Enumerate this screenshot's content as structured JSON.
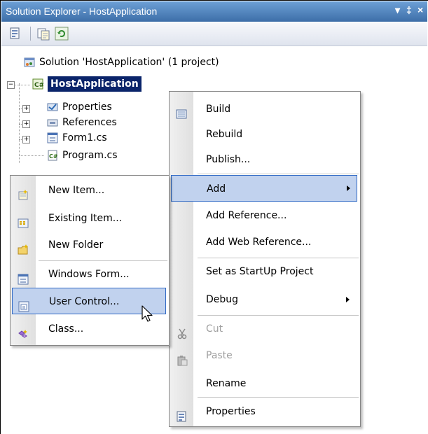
{
  "window": {
    "title": "Solution Explorer - HostApplication",
    "controls": {
      "dropdown": "▾",
      "pin": "‡",
      "close": "×"
    }
  },
  "toolbar": {
    "buttons": [
      {
        "icon": "properties-icon"
      },
      {
        "icon": "show-all-files-icon"
      },
      {
        "icon": "refresh-icon"
      }
    ]
  },
  "tree": {
    "solution": "Solution 'HostApplication' (1 project)",
    "project": "HostApplication",
    "items": [
      {
        "label": "Properties",
        "expandable": true
      },
      {
        "label": "References",
        "expandable": true
      },
      {
        "label": "Form1.cs",
        "expandable": true
      },
      {
        "label": "Program.cs",
        "expandable": false
      }
    ]
  },
  "context_menu": {
    "items": [
      {
        "label": "Build",
        "icon": "build-icon"
      },
      {
        "label": "Rebuild"
      },
      {
        "label": "Publish..."
      },
      {
        "label": "Add",
        "submenu": true,
        "highlighted": true
      },
      {
        "label": "Add Reference..."
      },
      {
        "label": "Add Web Reference..."
      },
      {
        "label": "Set as StartUp Project"
      },
      {
        "label": "Debug",
        "submenu": true
      },
      {
        "label": "Cut",
        "disabled": true,
        "icon": "cut-icon"
      },
      {
        "label": "Paste",
        "disabled": true,
        "icon": "paste-icon"
      },
      {
        "label": "Rename"
      },
      {
        "label": "Properties",
        "icon": "properties-icon"
      }
    ]
  },
  "add_submenu": {
    "items": [
      {
        "label": "New Item...",
        "icon": "new-item-icon"
      },
      {
        "label": "Existing Item...",
        "icon": "existing-item-icon"
      },
      {
        "label": "New Folder",
        "icon": "new-folder-icon"
      },
      {
        "label": "Windows Form...",
        "icon": "windows-form-icon"
      },
      {
        "label": "User Control...",
        "icon": "user-control-icon",
        "highlighted": true
      },
      {
        "label": "Class...",
        "icon": "class-icon"
      }
    ]
  },
  "colors": {
    "title_bar": "#3d6ea8",
    "selection": "#0a246a",
    "menu_highlight": "#c1d2ee",
    "menu_highlight_border": "#316ac5"
  }
}
